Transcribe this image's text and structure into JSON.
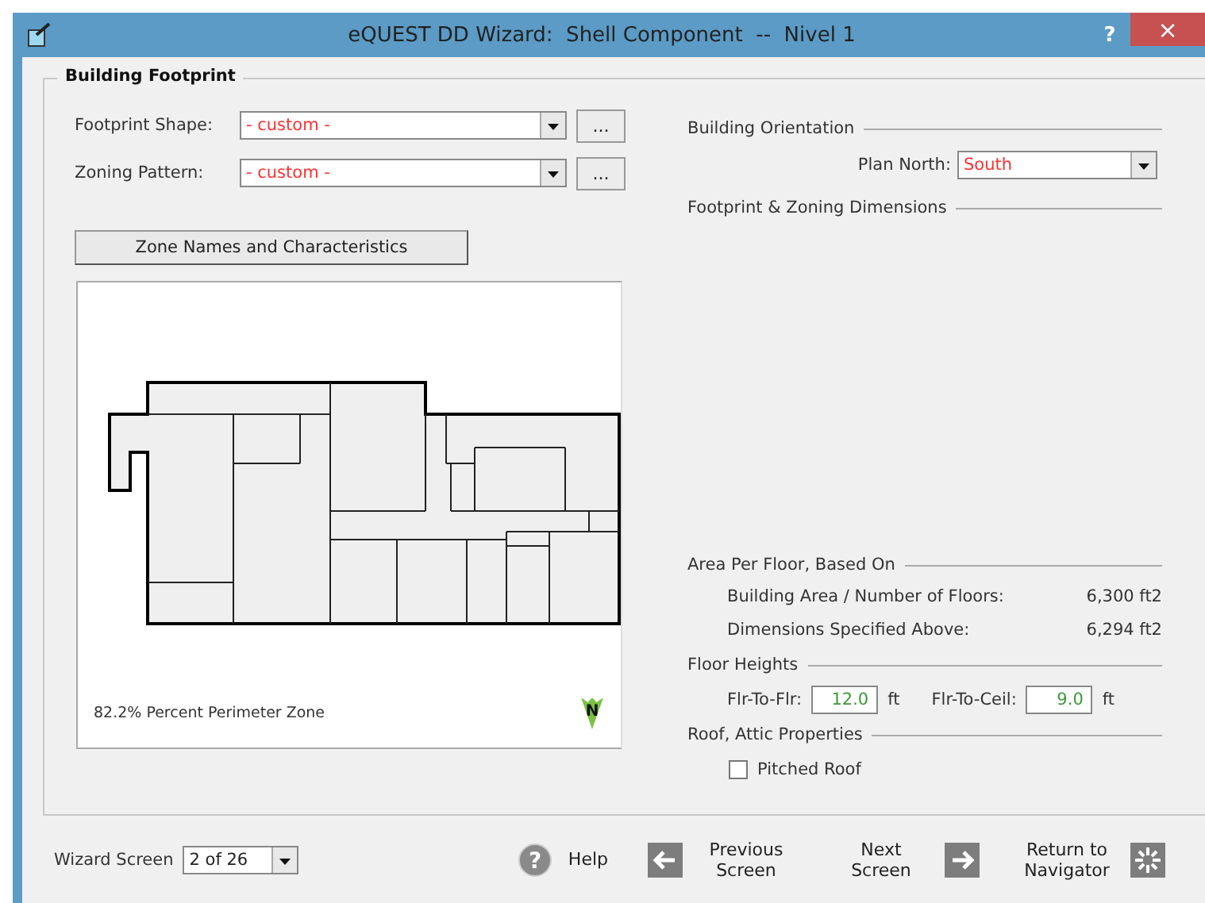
{
  "window": {
    "title": "eQUEST DD Wizard:  Shell Component  --  Nivel 1",
    "help_button": "?",
    "close_button": "×"
  },
  "building_footprint": {
    "title": "Building Footprint",
    "selectors": [
      {
        "label": "Footprint Shape:",
        "value": "- custom -",
        "button": "..."
      },
      {
        "label": "Zoning Pattern:",
        "value": "- custom -",
        "button": "..."
      }
    ],
    "zone_names_button": "Zone Names and Characteristics",
    "plan_view": {
      "caption": "82.2% Percent Perimeter Zone",
      "north": "N"
    },
    "building_orientation": {
      "title": "Building Orientation",
      "label": "Plan North:",
      "value": "South"
    },
    "dimensions": {
      "title": "Footprint & Zoning Dimensions"
    },
    "area_per_floor": {
      "title": "Area Per Floor, Based On",
      "rows": [
        {
          "label": "Building Area / Number of Floors:",
          "value": "6,300 ft2"
        },
        {
          "label": "Dimensions Specified Above:",
          "value": "6,294 ft2"
        }
      ]
    },
    "floor_heights": {
      "title": "Floor Heights",
      "fields": [
        {
          "label": "Flr-To-Flr:",
          "value": "12.0",
          "unit": "ft"
        },
        {
          "label": "Flr-To-Ceil:",
          "value": "9.0",
          "unit": "ft"
        }
      ]
    },
    "roof": {
      "title": "Roof, Attic Properties",
      "pitched_roof": {
        "label": "Pitched Roof",
        "checked": false
      }
    }
  },
  "footer": {
    "wizard_screen": {
      "label": "Wizard Screen",
      "value": "2 of 26"
    },
    "buttons": [
      {
        "kind": "help",
        "label": "Help",
        "icon": "?"
      },
      {
        "kind": "previous",
        "label": "Previous Screen"
      },
      {
        "kind": "next",
        "label": "Next Screen"
      },
      {
        "kind": "navigator",
        "label": "Return to Navigator"
      }
    ]
  }
}
